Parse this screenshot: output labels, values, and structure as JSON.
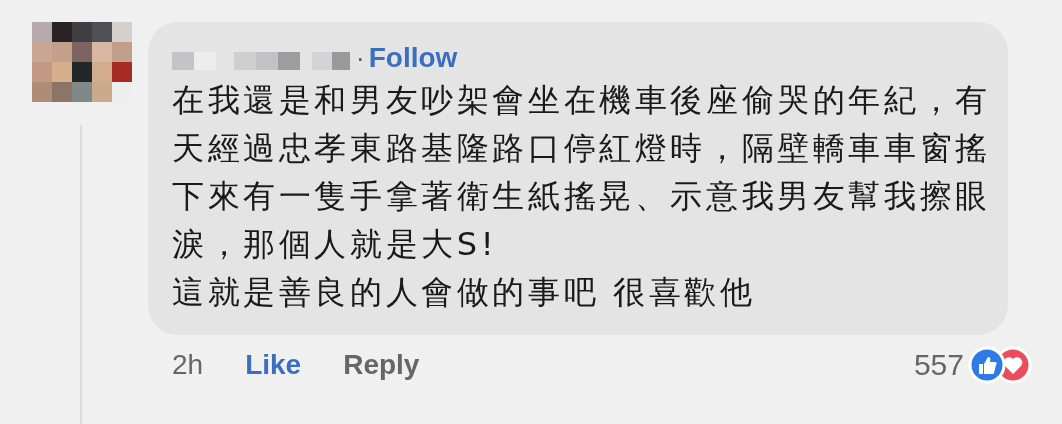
{
  "comment": {
    "separator": "·",
    "follow": "Follow",
    "lines": [
      "在我還是和男友吵架會坐在機車後座偷哭的年紀，有",
      "天經過忠孝東路基隆路口停紅燈時，隔壁轎車車窗搖",
      "下來有一隻手拿著衛生紙搖晃、示意我男友幫我擦眼",
      "淚，那個人就是大S!",
      "這就是善良的人會做的事吧 很喜歡他"
    ],
    "time": "2h",
    "like": {
      "label": "Like",
      "liked": true
    },
    "reply": "Reply",
    "reaction_count": "557"
  }
}
